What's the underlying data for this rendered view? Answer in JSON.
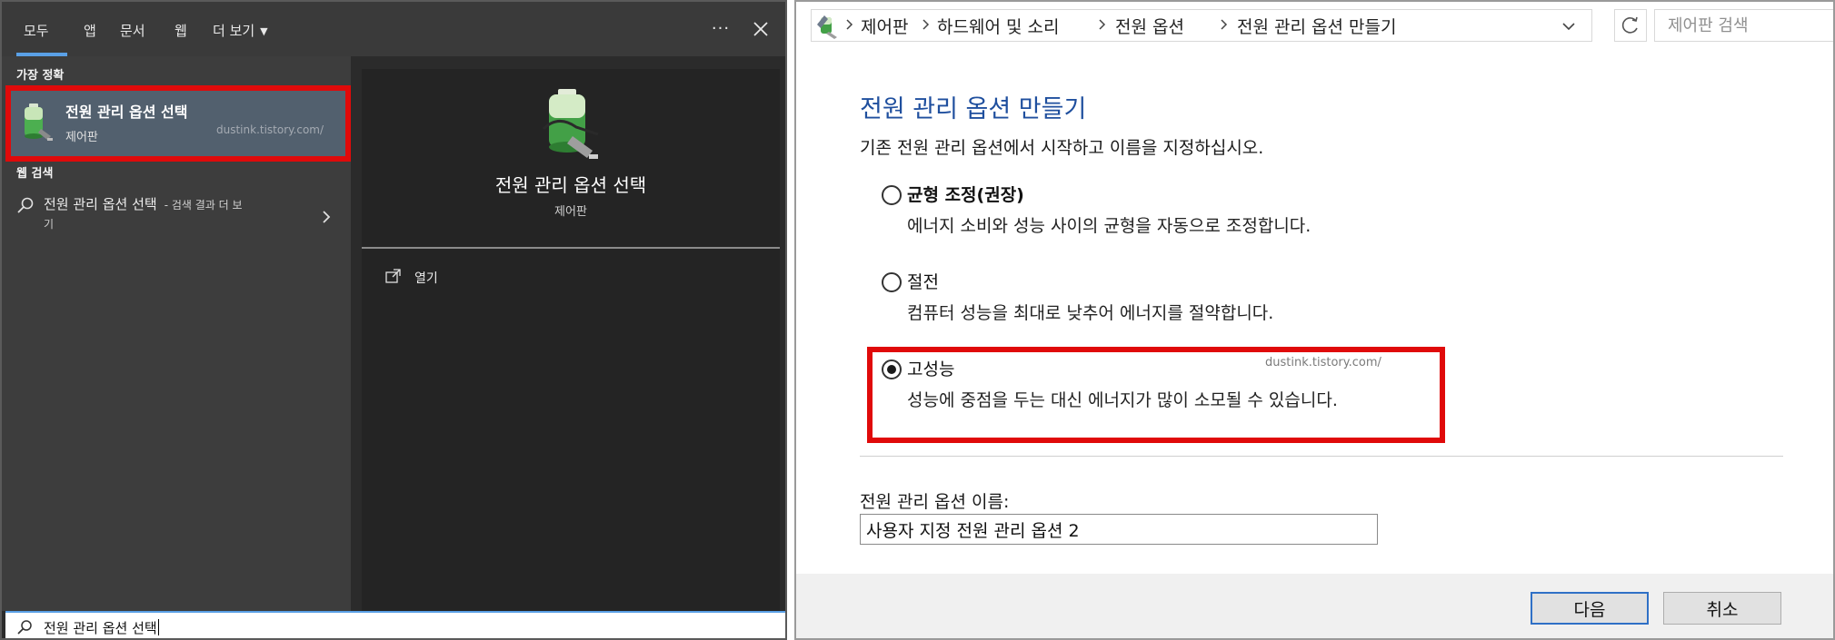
{
  "search_panel": {
    "tabs": [
      {
        "label": "모두"
      },
      {
        "label": "앱"
      },
      {
        "label": "문서"
      },
      {
        "label": "웹"
      },
      {
        "label": "더 보기"
      }
    ],
    "ellipsis": "···",
    "best_match_header": "가장 정확",
    "best_match": {
      "title": "전원 관리 옵션 선택",
      "subtitle": "제어판",
      "watermark": "dustink.tistory.com/"
    },
    "web_header": "웹 검색",
    "web_result": {
      "title": "전원 관리 옵션 선택",
      "suffix": "- 검색 결과 더 보",
      "suffix_cont": "기"
    },
    "preview": {
      "title": "전원 관리 옵션 선택",
      "subtitle": "제어판",
      "open_label": "열기"
    },
    "search_query": "전원 관리 옵션 선택"
  },
  "control_panel": {
    "breadcrumbs": [
      "제어판",
      "하드웨어 및 소리",
      "전원 옵션",
      "전원 관리 옵션 만들기"
    ],
    "search_placeholder": "제어판 검색",
    "heading": "전원 관리 옵션 만들기",
    "description": "기존 전원 관리 옵션에서 시작하고 이름을 지정하십시오.",
    "options": [
      {
        "label": "균형 조정(권장)",
        "desc": "에너지 소비와 성능 사이의 균형을 자동으로 조정합니다.",
        "selected": false
      },
      {
        "label": "절전",
        "desc": "컴퓨터 성능을 최대로 낮추어 에너지를 절약합니다.",
        "selected": false
      },
      {
        "label": "고성능",
        "desc": "성능에 중점을 두는 대신 에너지가 많이 소모될 수 있습니다.",
        "selected": true
      }
    ],
    "watermark": "dustink.tistory.com/",
    "name_label": "전원 관리 옵션 이름:",
    "name_value": "사용자 지정 전원 관리 옵션 2",
    "next_label": "다음",
    "cancel_label": "취소"
  },
  "colors": {
    "highlight": "#e00a0a",
    "heading_blue": "#1f4f9e",
    "tab_accent": "#5aa0e6",
    "panel_dark": "#2b2b2b",
    "selected_item": "#52606e"
  }
}
